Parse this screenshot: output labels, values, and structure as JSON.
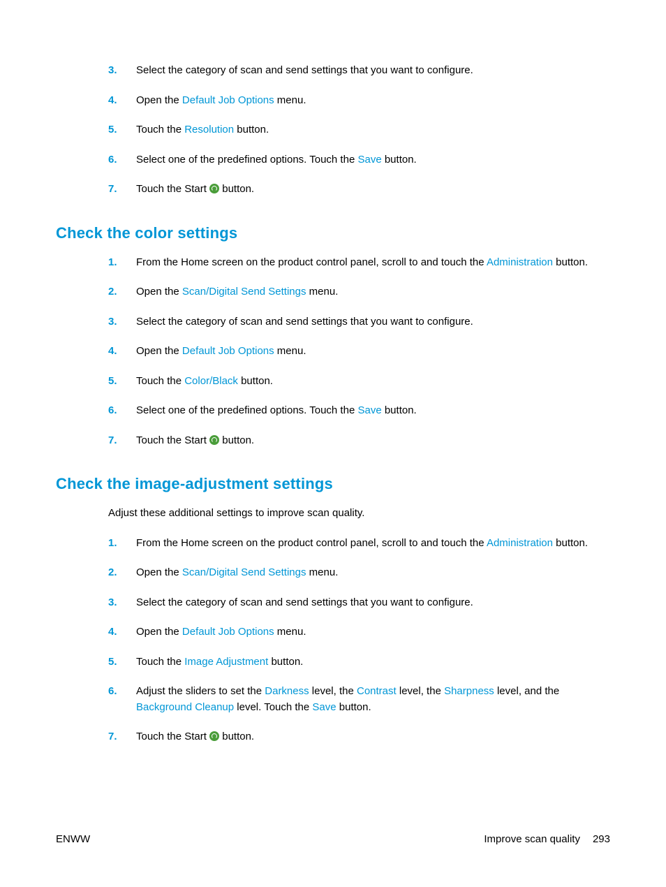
{
  "section0": {
    "items": [
      {
        "pre": "Select the category of scan and send settings that you want to configure."
      },
      {
        "pre": "Open the ",
        "ui": "Default Job Options",
        "post": " menu."
      },
      {
        "pre": "Touch the ",
        "ui": "Resolution",
        "post": " button."
      },
      {
        "pre": "Select one of the predefined options. Touch the ",
        "ui": "Save",
        "post": " button."
      },
      {
        "pre": "Touch the Start ",
        "icon": true,
        "post": " button."
      }
    ]
  },
  "section1": {
    "heading": "Check the color settings",
    "items": [
      {
        "pre": "From the Home screen on the product control panel, scroll to and touch the ",
        "ui": "Administration",
        "post": " button."
      },
      {
        "pre": "Open the ",
        "ui": "Scan/Digital Send Settings",
        "post": " menu."
      },
      {
        "pre": "Select the category of scan and send settings that you want to configure."
      },
      {
        "pre": "Open the ",
        "ui": "Default Job Options",
        "post": " menu."
      },
      {
        "pre": "Touch the ",
        "ui": "Color/Black",
        "post": " button."
      },
      {
        "pre": "Select one of the predefined options. Touch the ",
        "ui": "Save",
        "post": " button."
      },
      {
        "pre": "Touch the Start ",
        "icon": true,
        "post": " button."
      }
    ]
  },
  "section2": {
    "heading": "Check the image-adjustment settings",
    "intro": "Adjust these additional settings to improve scan quality.",
    "items": [
      {
        "pre": "From the Home screen on the product control panel, scroll to and touch the ",
        "ui": "Administration",
        "post": " button."
      },
      {
        "pre": "Open the ",
        "ui": "Scan/Digital Send Settings",
        "post": " menu."
      },
      {
        "pre": "Select the category of scan and send settings that you want to configure."
      },
      {
        "pre": "Open the ",
        "ui": "Default Job Options",
        "post": " menu."
      },
      {
        "pre": "Touch the ",
        "ui": "Image Adjustment",
        "post": " button."
      },
      {
        "multi": [
          {
            "t": "Adjust the sliders to set the "
          },
          {
            "t": "Darkness",
            "ui": true
          },
          {
            "t": " level, the "
          },
          {
            "t": "Contrast",
            "ui": true
          },
          {
            "t": " level, the "
          },
          {
            "t": "Sharpness",
            "ui": true
          },
          {
            "t": " level, and the "
          },
          {
            "t": "Background Cleanup",
            "ui": true
          },
          {
            "t": " level. Touch the "
          },
          {
            "t": "Save",
            "ui": true
          },
          {
            "t": " button."
          }
        ]
      },
      {
        "pre": "Touch the Start ",
        "icon": true,
        "post": " button."
      }
    ]
  },
  "footer": {
    "left": "ENWW",
    "rightText": "Improve scan quality",
    "pageNumber": "293"
  }
}
